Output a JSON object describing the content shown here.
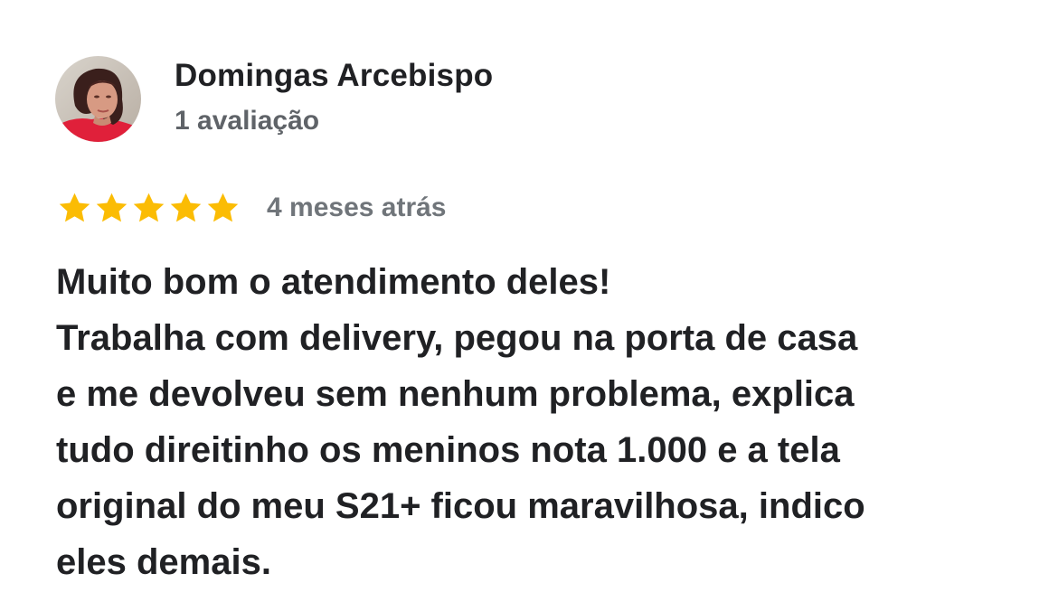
{
  "reviewer": {
    "name": "Domingas Arcebispo",
    "review_count": "1 avaliação",
    "avatar_icon": "user-photo-avatar"
  },
  "rating": {
    "stars": 5,
    "max_stars": 5,
    "star_color": "#fbbc04",
    "star_icon": "star-filled-icon",
    "time_ago": "4 meses atrás"
  },
  "review": {
    "lines": [
      "Muito bom o atendimento deles!",
      "Trabalha com delivery, pegou na porta de casa",
      "e me devolveu sem nenhum problema, explica",
      "tudo direitinho os meninos nota 1.000 e a tela",
      "original do meu S21+ ficou maravilhosa, indico",
      "eles demais."
    ]
  },
  "colors": {
    "primary_text": "#202124",
    "secondary_text": "#5f6368",
    "background": "#ffffff"
  }
}
